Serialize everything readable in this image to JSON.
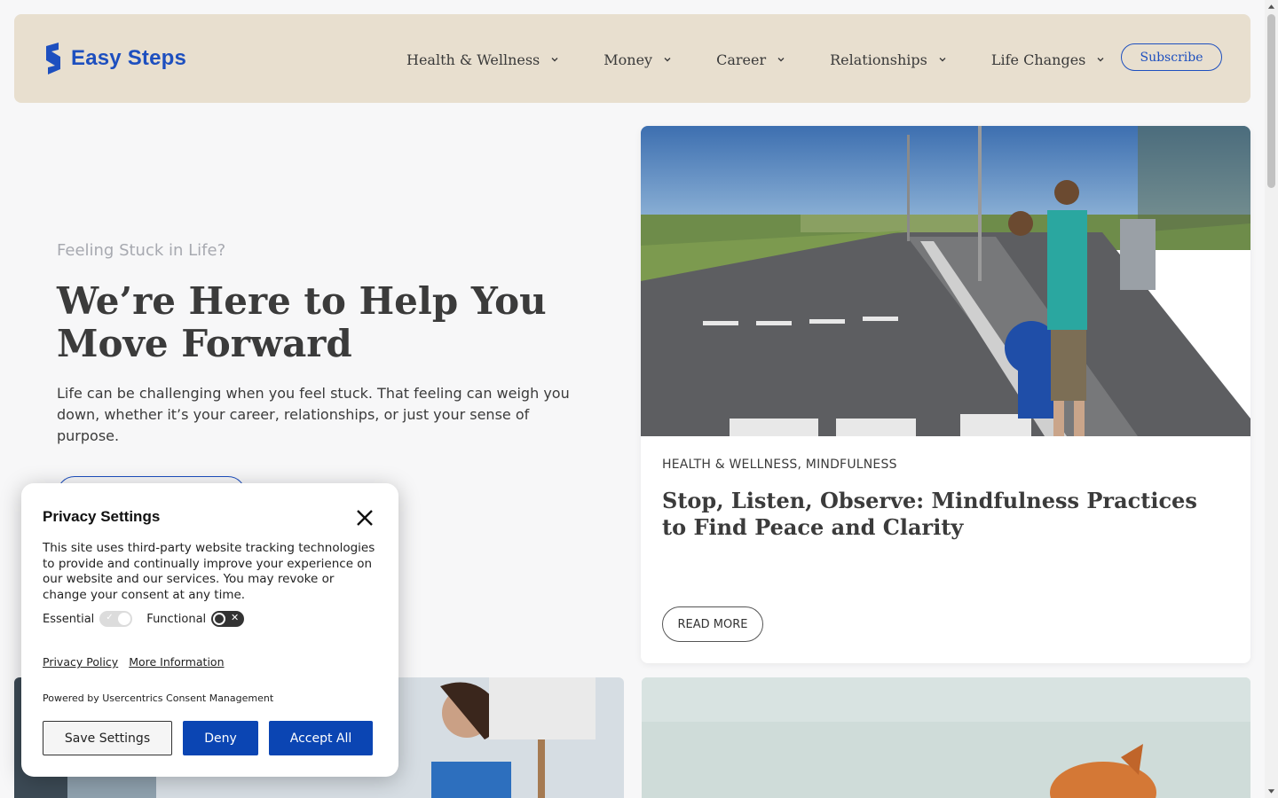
{
  "header": {
    "brand": "Easy Steps",
    "nav": [
      {
        "label": "Health & Wellness"
      },
      {
        "label": "Money"
      },
      {
        "label": "Career"
      },
      {
        "label": "Relationships"
      },
      {
        "label": "Life Changes"
      }
    ],
    "subscribe_label": "Subscribe"
  },
  "hero": {
    "eyebrow": "Feeling Stuck in Life?",
    "title": "We’re Here to Help You Move Forward",
    "text": "Life can be challenging when you feel stuck. That feeling can weigh you down, whether it’s your career, relationships, or just your sense of purpose."
  },
  "featured": {
    "categories": "HEALTH & WELLNESS, MINDFULNESS",
    "title": "Stop, Listen, Observe: Mindfulness Practices to Find Peace and Clarity",
    "read_more": "READ MORE"
  },
  "consent": {
    "title": "Privacy Settings",
    "text": "This site uses third-party website tracking technologies to provide and continually improve your experience on our website and our services. You may revoke or change your consent at any time.",
    "toggles": [
      {
        "label": "Essential"
      },
      {
        "label": "Functional"
      }
    ],
    "links": {
      "privacy": "Privacy Policy",
      "more": "More Information"
    },
    "powered": "Powered by Usercentrics Consent Management",
    "buttons": {
      "save": "Save Settings",
      "deny": "Deny",
      "accept": "Accept All"
    }
  },
  "colors": {
    "brand": "#1d4fbf",
    "header_bg": "#e8dfcf",
    "consent_button": "#0b45b3"
  }
}
